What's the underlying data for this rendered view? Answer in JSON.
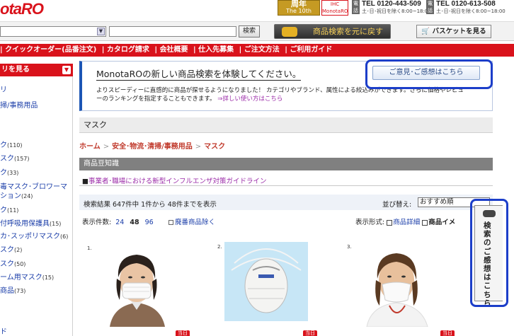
{
  "header": {
    "logo": "otaRO",
    "anniversary": {
      "big": "周年",
      "sub": "The 10th Anniversary"
    },
    "monotaro_badge": {
      "top": "IHC",
      "mid": "MonotaRO",
      "bottom": "サイト"
    },
    "phones": [
      {
        "icon": "電話",
        "number": "TEL 0120-443-509",
        "hours": "土･日･祝日を除く8:00~18:00"
      },
      {
        "icon": "電話",
        "number": "TEL 0120-613-508",
        "hours": "土･日･祝日を除く8:00~18:00"
      }
    ]
  },
  "search": {
    "category_value": "",
    "input_value": "",
    "button_label": "検索",
    "revert_label": "商品検索を元に戻す",
    "basket_label": "バスケットを見る"
  },
  "nav": {
    "items": [
      "| クイックオーダー(品番注文)",
      "| カタログ請求",
      "| 会社概要",
      "| 仕入先募集",
      "| ご注文方法",
      "| ご利用ガイド"
    ]
  },
  "sidebar": {
    "header": "リを見る",
    "toggle_icon": "chevron-down",
    "items": [
      {
        "label": "リ",
        "count": ""
      },
      {
        "label": "掃/事務用品",
        "count": ""
      },
      {
        "label": "ク",
        "count": "(110)"
      },
      {
        "label": "スク",
        "count": "(157)"
      },
      {
        "label": "ク",
        "count": "(33)"
      },
      {
        "label": "毒マスク･ブロワーマ",
        "count": ""
      },
      {
        "label": "ション",
        "count": "(24)"
      },
      {
        "label": "ク",
        "count": "(11)"
      },
      {
        "label": "付呼吸用保護具",
        "count": "(15)"
      },
      {
        "label": "カ･スッポリマスク",
        "count": "(6)"
      },
      {
        "label": "スク",
        "count": "(2)"
      },
      {
        "label": "スク",
        "count": "(50)"
      },
      {
        "label": "ーム用マスク",
        "count": "(15)"
      },
      {
        "label": "商品",
        "count": "(73)"
      },
      {
        "label": "ド",
        "count": ""
      }
    ]
  },
  "promo": {
    "title": "MonotaROの新しい商品検索を体験してください。",
    "body_line1": "よりスピーディーに直感的に商品が探せるようになりました！ カテゴリやブランド、属性による絞込みができます。さらに価格やレビュ",
    "body_line2": "ーのランキングを指定することもできます。",
    "body_link": "⇒詳しい使い方はこちら",
    "feedback_button": "ご意見･ご感想はこちら"
  },
  "category_title": "マスク",
  "breadcrumb": [
    "ホーム",
    "安全･物流･清掃/事務用品",
    "マスク"
  ],
  "knowledge": {
    "header": "商品豆知識",
    "link": "事業者･職場における新型インフルエンザ対策ガイドライン"
  },
  "results": {
    "summary": "検索結果 647件中 1件から 48件までを表示",
    "sort_label": "並び替え:",
    "sort_value": "おすすめ順",
    "per_page_label": "表示件数:",
    "per_page_options": [
      "24",
      "48",
      "96"
    ],
    "per_page_selected": "48",
    "discontinued_label": "廃番商品除く",
    "display_format_label": "表示形式:",
    "format_detail": "商品詳細",
    "format_image": "商品イメ"
  },
  "products": [
    {
      "num": "1.",
      "tag": "当日"
    },
    {
      "num": "2.",
      "tag": "当日"
    },
    {
      "num": "3.",
      "tag": "当日"
    }
  ],
  "feedback_tab": {
    "text": "検索のご感想はこちら"
  },
  "colors": {
    "brand_red": "#d9121b",
    "highlight_blue": "#1c3ec9",
    "link_blue": "#1a3da8",
    "visited_purple": "#9b2ca8"
  }
}
